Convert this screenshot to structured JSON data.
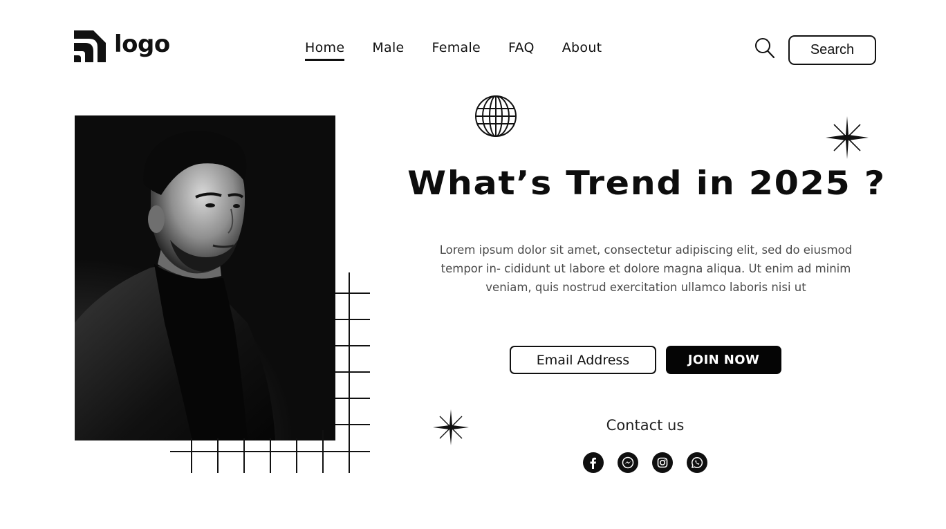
{
  "header": {
    "logo_text": "logo",
    "nav": [
      {
        "label": "Home",
        "active": true
      },
      {
        "label": "Male",
        "active": false
      },
      {
        "label": "Female",
        "active": false
      },
      {
        "label": "FAQ",
        "active": false
      },
      {
        "label": "About",
        "active": false
      }
    ],
    "search_label": "Search",
    "search_icon": "search-icon"
  },
  "hero": {
    "image_description_icon": "portrait-photo",
    "headline": "What’s Trend in 2025 ?",
    "paragraph": "Lorem ipsum dolor sit amet, consectetur adipiscing elit, sed do eiusmod tempor in- cididunt ut labore et dolore magna aliqua. Ut enim ad minim veniam, quis nostrud exercitation ullamco laboris nisi ut",
    "email_placeholder": "Email Address",
    "join_label": "JOIN NOW",
    "decorations": [
      "globe-icon",
      "sparkle-icon",
      "sparkle-icon"
    ]
  },
  "contact": {
    "title": "Contact us",
    "icons": [
      "facebook-icon",
      "messenger-icon",
      "instagram-icon",
      "whatsapp-icon"
    ]
  },
  "colors": {
    "primary": "#050505",
    "background": "#ffffff",
    "text_muted": "#4a4a4a"
  }
}
